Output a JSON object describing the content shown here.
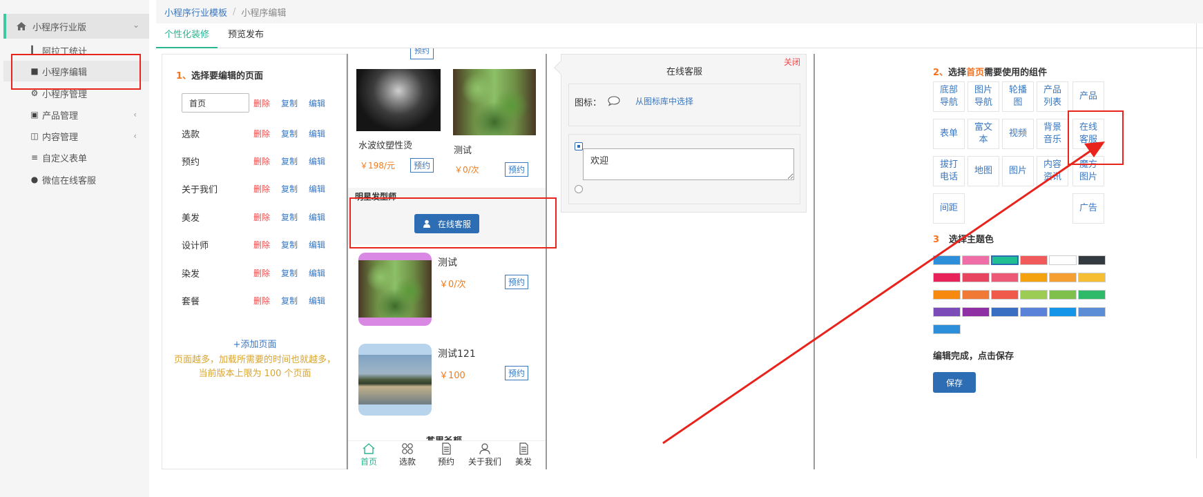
{
  "sidebar": {
    "header": "小程序行业版",
    "items": [
      {
        "label": "阿拉丁统计",
        "icon": "bar-chart-icon"
      },
      {
        "label": "小程序编辑",
        "icon": "book-icon"
      },
      {
        "label": "小程序管理",
        "icon": "wrench-icon"
      },
      {
        "label": "产品管理",
        "icon": "cart-icon"
      },
      {
        "label": "内容管理",
        "icon": "folder-icon"
      },
      {
        "label": "自定义表单",
        "icon": "list-icon"
      },
      {
        "label": "微信在线客服",
        "icon": "user-icon"
      }
    ]
  },
  "breadcrumb": {
    "root": "小程序行业模板",
    "sep": "/",
    "current": "小程序编辑"
  },
  "tabs": [
    "个性化装修",
    "预览发布"
  ],
  "pages_panel": {
    "step_num": "1、",
    "title": "选择要编辑的页面",
    "first_page_value": "首页",
    "actions": {
      "delete": "删除",
      "copy": "复制",
      "edit": "编辑"
    },
    "pages": [
      "选款",
      "预约",
      "关于我们",
      "美发",
      "设计师",
      "染发",
      "套餐"
    ],
    "add_page": "+添加页面",
    "note_line1": "页面越多，加载所需要的时间也就越多，",
    "note_line2": "当前版本上限为 100 个页面"
  },
  "phone": {
    "top_cut_label": "预约",
    "products": [
      {
        "name": "水波纹塑性烫",
        "price": "￥198/元",
        "btn": "预约"
      },
      {
        "name": "测试",
        "price": "￥0/次",
        "btn": "预约"
      }
    ],
    "section_title": "明星发型师",
    "cs_button": "在线客服",
    "list": [
      {
        "name": "测试",
        "price": "￥0/次",
        "btn": "预约"
      },
      {
        "name": "测试121",
        "price": "￥100",
        "btn": "预约"
      }
    ],
    "cut_text": "套单名称",
    "nav": [
      {
        "label": "首页",
        "icon": "home-icon"
      },
      {
        "label": "选款",
        "icon": "grid-icon"
      },
      {
        "label": "预约",
        "icon": "document-icon"
      },
      {
        "label": "关于我们",
        "icon": "person-icon"
      },
      {
        "label": "美发",
        "icon": "document-icon"
      }
    ]
  },
  "editor": {
    "close": "关闭",
    "title": "在线客服",
    "icon_label": "图标：",
    "icon_pick": "从图标库中选择",
    "textarea_value": "欢迎"
  },
  "components_panel": {
    "step_num": "2、",
    "title_pre": "选择",
    "title_hl": "首页",
    "title_post": "需要使用的组件",
    "components": [
      {
        "l1": "底部",
        "l2": "导航"
      },
      {
        "l1": "图片",
        "l2": "导航"
      },
      {
        "l1": "轮播",
        "l2": "图"
      },
      {
        "l1": "产品",
        "l2": "列表"
      },
      {
        "l1": "产品",
        "l2": ""
      },
      {
        "l1": "表单",
        "l2": ""
      },
      {
        "l1": "富文",
        "l2": "本"
      },
      {
        "l1": "视频",
        "l2": ""
      },
      {
        "l1": "背景",
        "l2": "音乐"
      },
      {
        "l1": "在线",
        "l2": "客服"
      },
      {
        "l1": "拔打",
        "l2": "电话"
      },
      {
        "l1": "地图",
        "l2": ""
      },
      {
        "l1": "图片",
        "l2": ""
      },
      {
        "l1": "内容",
        "l2": "资讯"
      },
      {
        "l1": "魔方",
        "l2": "图片"
      },
      {
        "l1": "间距",
        "l2": ""
      },
      {
        "l1": "广告",
        "l2": ""
      }
    ],
    "theme_step_num": "3",
    "theme_title": "选择主题色",
    "theme_colors": [
      "#2d8fd9",
      "#f06ea7",
      "#1fbf93",
      "#f15a5a",
      "#ffffff",
      "#333a40",
      "#e8235a",
      "#e84560",
      "#ed5a78",
      "#f5a211",
      "#f59e32",
      "#f6bf33",
      "#f7890f",
      "#f07a35",
      "#ef5a4a",
      "#9ccc53",
      "#7ec04b",
      "#2fba6a",
      "#7b4bb8",
      "#8e2fa3",
      "#3a6ec2",
      "#5a82d9",
      "#1595e8",
      "#5b8cd6",
      "#2d8fd9"
    ],
    "selected_color": "#1fbf93",
    "done_text": "编辑完成，点击保存",
    "save": "保存"
  },
  "colors": {
    "accent": "#2bb58f",
    "link": "#3a77c1",
    "danger": "#ef4b4b",
    "primary_btn": "#2d6db3",
    "annotation": "#e8231b"
  }
}
